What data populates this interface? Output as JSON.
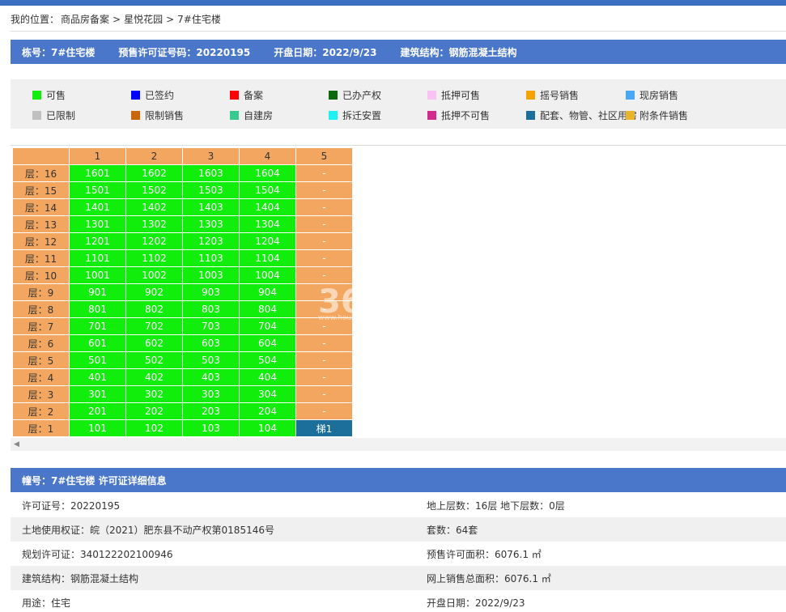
{
  "breadcrumb": {
    "prefix": "我的位置：",
    "items": [
      "商品房备案",
      "星悦花园",
      "7#住宅楼"
    ],
    "separator": ">"
  },
  "infobar": {
    "building": "栋号：7#住宅楼",
    "permit": "预售许可证号码：20220195",
    "open_date": "开盘日期：2022/9/23",
    "structure": "建筑结构：钢筋混凝土结构"
  },
  "legend": [
    {
      "label": "可售",
      "color": "#12ee0c"
    },
    {
      "label": "已签约",
      "color": "#0000ff"
    },
    {
      "label": "备案",
      "color": "#ff0000"
    },
    {
      "label": "已办产权",
      "color": "#0a6b0a"
    },
    {
      "label": "抵押可售",
      "color": "#f9c2f2"
    },
    {
      "label": "摇号销售",
      "color": "#f5a300"
    },
    {
      "label": "现房销售",
      "color": "#4aa7f5"
    },
    {
      "label": "已限制",
      "color": "#c0c0c0"
    },
    {
      "label": "限制销售",
      "color": "#c8660a"
    },
    {
      "label": "自建房",
      "color": "#38c98e"
    },
    {
      "label": "拆迁安置",
      "color": "#1ff0f5"
    },
    {
      "label": "抵押不可售",
      "color": "#d22a8c"
    },
    {
      "label": "配套、物管、社区用房",
      "color": "#1b6f9a"
    },
    {
      "label": "附条件销售",
      "color": "#e8b42a"
    }
  ],
  "grid": {
    "columns": [
      "1",
      "2",
      "3",
      "4",
      "5"
    ],
    "rows": [
      {
        "floor": "层：16",
        "units": [
          "1601",
          "1602",
          "1603",
          "1604",
          "-"
        ]
      },
      {
        "floor": "层：15",
        "units": [
          "1501",
          "1502",
          "1503",
          "1504",
          "-"
        ]
      },
      {
        "floor": "层：14",
        "units": [
          "1401",
          "1402",
          "1403",
          "1404",
          "-"
        ]
      },
      {
        "floor": "层：13",
        "units": [
          "1301",
          "1302",
          "1303",
          "1304",
          "-"
        ]
      },
      {
        "floor": "层：12",
        "units": [
          "1201",
          "1202",
          "1203",
          "1204",
          "-"
        ]
      },
      {
        "floor": "层：11",
        "units": [
          "1101",
          "1102",
          "1103",
          "1104",
          "-"
        ]
      },
      {
        "floor": "层：10",
        "units": [
          "1001",
          "1002",
          "1003",
          "1004",
          "-"
        ]
      },
      {
        "floor": "层：9",
        "units": [
          "901",
          "902",
          "903",
          "904",
          "-"
        ]
      },
      {
        "floor": "层：8",
        "units": [
          "801",
          "802",
          "803",
          "804",
          "-"
        ]
      },
      {
        "floor": "层：7",
        "units": [
          "701",
          "702",
          "703",
          "704",
          "-"
        ]
      },
      {
        "floor": "层：6",
        "units": [
          "601",
          "602",
          "603",
          "604",
          "-"
        ]
      },
      {
        "floor": "层：5",
        "units": [
          "501",
          "502",
          "503",
          "504",
          "-"
        ]
      },
      {
        "floor": "层：4",
        "units": [
          "401",
          "402",
          "403",
          "404",
          "-"
        ]
      },
      {
        "floor": "层：3",
        "units": [
          "301",
          "302",
          "303",
          "304",
          "-"
        ]
      },
      {
        "floor": "层：2",
        "units": [
          "201",
          "202",
          "203",
          "204",
          "-"
        ]
      },
      {
        "floor": "层：1",
        "units": [
          "101",
          "102",
          "103",
          "104",
          "梯1"
        ]
      }
    ]
  },
  "detail": {
    "title": "幢号：7#住宅楼 许可证详细信息",
    "rows": [
      {
        "left": "许可证号：20220195",
        "right": "地上层数：16层  地下层数：0层"
      },
      {
        "left": "土地使用权证：皖（2021）肥东县不动产权第0185146号",
        "right": "套数：64套"
      },
      {
        "left": "规划许可证：340122202100946",
        "right": "预售许可面积：6076.1 ㎡"
      },
      {
        "left": "建筑结构：钢筋混凝土结构",
        "right": "网上销售总面积：6076.1 ㎡"
      },
      {
        "left": "用途：住宅",
        "right": "开盘日期：2022/9/23"
      }
    ]
  }
}
